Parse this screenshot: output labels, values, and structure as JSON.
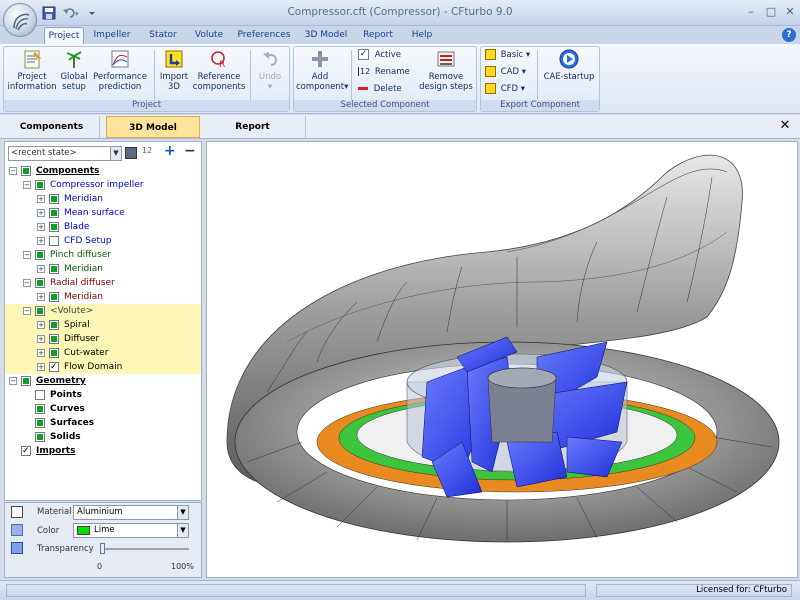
{
  "app": {
    "title": "Compressor.cft (Compressor) - CFturbo 9.0",
    "window_controls": {
      "minimize": "–",
      "restore": "□",
      "close": "✕"
    }
  },
  "tabs": [
    "Project",
    "Impeller",
    "Stator",
    "Volute",
    "Preferences",
    "3D Model",
    "Report",
    "Help"
  ],
  "active_tab": "Project",
  "help_icon": "?",
  "ribbon": {
    "project_group": {
      "label": "Project",
      "buttons": [
        {
          "line1": "Project",
          "line2": "information",
          "icon": "notepad-icon"
        },
        {
          "line1": "Global",
          "line2": "setup",
          "icon": "palm-icon"
        },
        {
          "line1": "Performance",
          "line2": "prediction",
          "icon": "graph-icon"
        },
        {
          "line1": "Import",
          "line2": "3D",
          "icon": "import-icon"
        },
        {
          "line1": "Reference",
          "line2": "components",
          "icon": "reference-icon"
        },
        {
          "line1": "Undo",
          "line2": "▾",
          "icon": "undo-icon"
        }
      ]
    },
    "component_group": {
      "label": "Selected Component",
      "add_label": "Add",
      "add_label2": "component▾",
      "active": "Active",
      "rename_prefix": "12",
      "rename": "Rename",
      "delete": "Delete",
      "remove_line1": "Remove",
      "remove_line2": "design steps"
    },
    "export_group": {
      "label": "Export Component",
      "basic": "Basic ▾",
      "cad": "CAD ▾",
      "cfd": "CFD ▾",
      "cae": "CAE-startup"
    }
  },
  "panel_tabs": [
    "Components",
    "3D Model",
    "Report"
  ],
  "active_panel_tab": "3D Model",
  "close_panel": "✕",
  "state_select": {
    "value": "<recent state>",
    "toolbar": [
      "12",
      "+",
      "−"
    ]
  },
  "tree": [
    {
      "label": "Components",
      "level": 0,
      "color": "#000000",
      "bold": true,
      "underline": true,
      "expander": "−",
      "checked": "on"
    },
    {
      "label": "Compressor impeller",
      "level": 1,
      "color": "#0000c8",
      "expander": "−",
      "checked": "on"
    },
    {
      "label": "Meridian",
      "level": 2,
      "color": "#0000c8",
      "expander": "+",
      "checked": "on"
    },
    {
      "label": "Mean surface",
      "level": 2,
      "color": "#0000c8",
      "expander": "+",
      "checked": "on"
    },
    {
      "label": "Blade",
      "level": 2,
      "color": "#0000c8",
      "expander": "+",
      "checked": "on"
    },
    {
      "label": "CFD Setup",
      "level": 2,
      "color": "#0000c8",
      "expander": "+",
      "checked": "off"
    },
    {
      "label": "Pinch diffuser",
      "level": 1,
      "color": "#006400",
      "expander": "−",
      "checked": "on"
    },
    {
      "label": "Meridian",
      "level": 2,
      "color": "#006400",
      "expander": "+",
      "checked": "on"
    },
    {
      "label": "Radial diffuser",
      "level": 1,
      "color": "#7a0000",
      "expander": "−",
      "checked": "on"
    },
    {
      "label": "Meridian",
      "level": 2,
      "color": "#7a0000",
      "expander": "+",
      "checked": "on"
    },
    {
      "label": "<Volute>",
      "level": 1,
      "color": "#444444",
      "expander": "−",
      "checked": "on",
      "highlight": true
    },
    {
      "label": "Spiral",
      "level": 2,
      "color": "#000000",
      "expander": "+",
      "checked": "on",
      "highlight": true
    },
    {
      "label": "Diffuser",
      "level": 2,
      "color": "#000000",
      "expander": "+",
      "checked": "on",
      "highlight": true
    },
    {
      "label": "Cut-water",
      "level": 2,
      "color": "#000000",
      "expander": "+",
      "checked": "on",
      "highlight": true
    },
    {
      "label": "Flow Domain",
      "level": 2,
      "color": "#000000",
      "expander": "+",
      "checked": "check",
      "highlight": true
    },
    {
      "label": "Geometry",
      "level": 0,
      "color": "#000000",
      "bold": true,
      "underline": true,
      "expander": "−",
      "checked": "on"
    },
    {
      "label": "Points",
      "level": 1,
      "color": "#000000",
      "bold": true,
      "expander": "",
      "checked": "off"
    },
    {
      "label": "Curves",
      "level": 1,
      "color": "#000000",
      "bold": true,
      "expander": "",
      "checked": "on"
    },
    {
      "label": "Surfaces",
      "level": 1,
      "color": "#000000",
      "bold": true,
      "expander": "",
      "checked": "on"
    },
    {
      "label": "Solids",
      "level": 1,
      "color": "#000000",
      "bold": true,
      "expander": "",
      "checked": "on"
    },
    {
      "label": "Imports",
      "level": 0,
      "color": "#000000",
      "bold": true,
      "underline": true,
      "expander": "",
      "checked": "check"
    }
  ],
  "properties": {
    "material_label": "Material",
    "material_value": "Aluminium",
    "color_label": "Color",
    "color_value": "Lime",
    "color_swatch": "#00e000",
    "transparency_label": "Transparency",
    "transparency_min": "0",
    "transparency_max": "100%",
    "transparency_value": 0
  },
  "status": {
    "license": "Licensed for: CFturbo"
  }
}
